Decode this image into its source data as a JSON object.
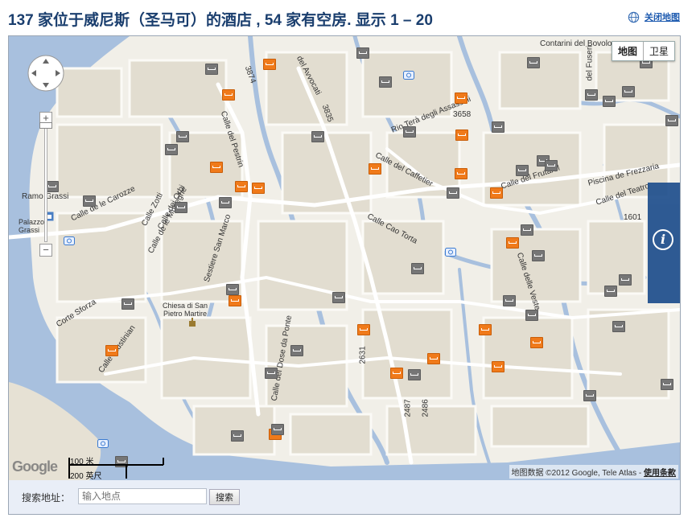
{
  "header": {
    "title": "137 家位于威尼斯（圣马可）的酒店 , 54 家有空房. 显示 1 – 20",
    "close_map": "关闭地图"
  },
  "map": {
    "map_type": {
      "map": "地图",
      "satellite": "卫星"
    },
    "zoom": {
      "plus": "+",
      "minus": "−"
    },
    "info_label": "i",
    "google_logo": "Google",
    "scale": {
      "metric": "100 米",
      "imperial": "200 英尺"
    },
    "copyright": "地图数据 ©2012 Google, Tele Atlas - ",
    "terms": "使用条款",
    "streets": [
      "Contarini del Bovolo",
      "del Fuseri",
      "del Avvocati",
      "3874",
      "3835",
      "Rio Terà degli Assassini",
      "3658",
      "Calle del Pestrin",
      "Calle del Caffetier",
      "Calle del Frutarol",
      "Piscina de Frezzaria",
      "Ramo Grassi",
      "Palazzo Grassi",
      "Calle de le Carozze",
      "Calle Zotti",
      "Calle dei Orbi",
      "Calle de le Muneghe",
      "Calle Cao Torta",
      "Calle del Teatro",
      "1601",
      "Calle delle Veste",
      "Sestiere San Marco",
      "Corte Sforza",
      "Chiesa di San Pietro Martire",
      "Calle Giustinian",
      "Calle del Dose da Ponte",
      "2631",
      "2487",
      "2486"
    ]
  },
  "search": {
    "label": "搜索地址：",
    "placeholder": "输入地点",
    "button": "搜索"
  },
  "colors": {
    "title": "#1a3e6e",
    "water": "#a8c0de",
    "land": "#f1efe8",
    "block": "#e2ddd0",
    "hotel_available": "#f07a1a",
    "hotel_other": "#767676",
    "info_tab": "#1e4e8c"
  }
}
